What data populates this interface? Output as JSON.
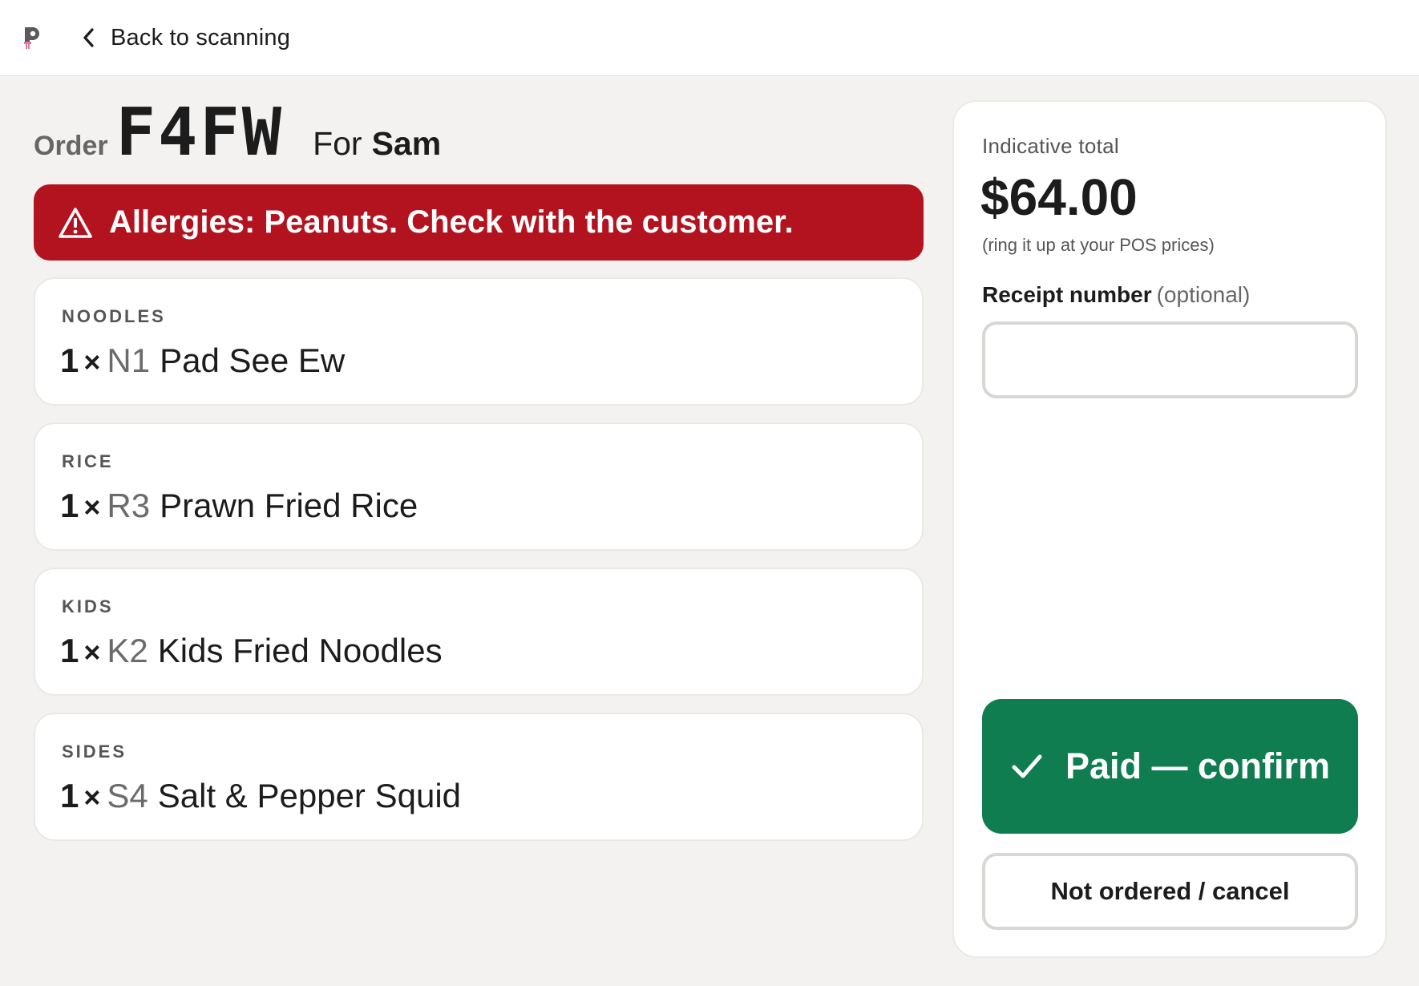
{
  "header": {
    "logo_icon": "popsicle-logo-icon",
    "back_icon": "chevron-left-icon",
    "back_label": "Back to scanning"
  },
  "order": {
    "label": "Order",
    "code": "F4FW",
    "for_label": "For",
    "customer_name": "Sam"
  },
  "allergy": {
    "icon": "warning-triangle-icon",
    "message": "Allergies: Peanuts. Check with the customer.",
    "color": "#b3131f"
  },
  "items": [
    {
      "category": "NOODLES",
      "qty": "1",
      "times": "×",
      "code": "N1",
      "name": "Pad See Ew"
    },
    {
      "category": "RICE",
      "qty": "1",
      "times": "×",
      "code": "R3",
      "name": "Prawn Fried Rice"
    },
    {
      "category": "KIDS",
      "qty": "1",
      "times": "×",
      "code": "K2",
      "name": "Kids Fried Noodles"
    },
    {
      "category": "SIDES",
      "qty": "1",
      "times": "×",
      "code": "S4",
      "name": "Salt & Pepper Squid"
    }
  ],
  "summary": {
    "total_label": "Indicative total",
    "total_value": "$64.00",
    "total_note": "(ring it up at your POS prices)",
    "receipt_label": "Receipt number",
    "receipt_optional": "(optional)",
    "receipt_value": "",
    "receipt_placeholder": ""
  },
  "actions": {
    "paid_icon": "checkmark-icon",
    "paid_label": "Paid — confirm",
    "paid_color": "#0f7d4f",
    "cancel_label": "Not ordered / cancel"
  }
}
